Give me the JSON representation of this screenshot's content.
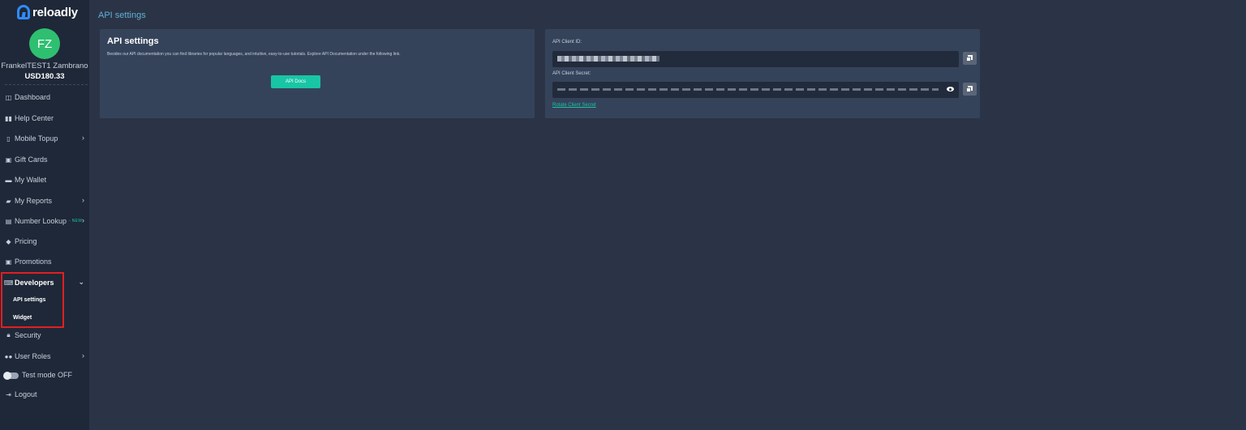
{
  "brand": {
    "name": "reloadly"
  },
  "user": {
    "initials": "FZ",
    "name": "FrankelTEST1 Zambrano",
    "balance": "USD180.33"
  },
  "nav": {
    "dashboard": "Dashboard",
    "help_center": "Help Center",
    "mobile_topup": "Mobile Topup",
    "gift_cards": "Gift Cards",
    "my_wallet": "My Wallet",
    "my_reports": "My Reports",
    "number_lookup": "Number Lookup",
    "number_lookup_badge": "- NEW",
    "pricing": "Pricing",
    "promotions": "Promotions",
    "developers": "Developers",
    "api_settings": "API settings",
    "widget": "Widget",
    "security": "Security",
    "user_roles": "User Roles",
    "test_mode": "Test mode OFF",
    "logout": "Logout"
  },
  "page": {
    "title": "API settings"
  },
  "left_card": {
    "title": "API settings",
    "description": "Besides our API documentation you can find libraries for popular languages, and intuitive, easy-to-use tutorials. Explore API Documentation under the following link.",
    "button": "API Docs"
  },
  "right_card": {
    "client_id_label": "API Client ID:",
    "client_secret_label": "API Client Secret:",
    "rotate_link": "Rotate Client Secret"
  },
  "colors": {
    "accent": "#18c6a5",
    "highlight": "#e02020",
    "avatar": "#2fbf71",
    "brand": "#2f8cff"
  }
}
